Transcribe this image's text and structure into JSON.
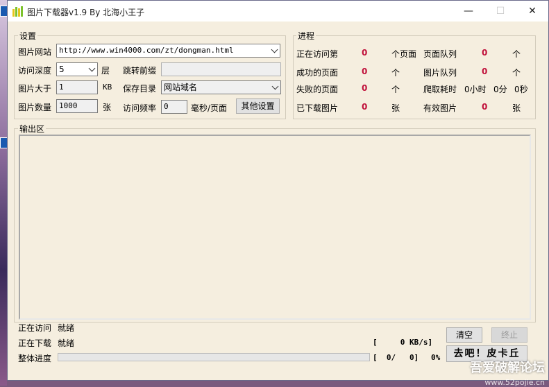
{
  "window": {
    "title": "图片下载器v1.9 By 北海小王子",
    "minimize_glyph": "—",
    "maximize_glyph": "☐",
    "close_glyph": "✕"
  },
  "settings": {
    "group_label": "设置",
    "site_label": "图片网站",
    "site_value": "http://www.win4000.com/zt/dongman.html",
    "depth_label": "访问深度",
    "depth_value": "5",
    "depth_unit": "层",
    "redirect_label": "跳转前缀",
    "redirect_value": "",
    "size_label": "图片大于",
    "size_value": "1",
    "size_unit": "KB",
    "savedir_label": "保存目录",
    "savedir_value": "网站域名",
    "count_label": "图片数量",
    "count_value": "1000",
    "count_unit": "张",
    "freq_label": "访问频率",
    "freq_value": "0",
    "freq_unit": "毫秒/页面",
    "other_settings_button": "其他设置"
  },
  "progress_panel": {
    "group_label": "进程",
    "visiting_label": "正在访问第",
    "visiting_value": "0",
    "visiting_unit": "个页面",
    "page_queue_label": "页面队列",
    "page_queue_value": "0",
    "page_queue_unit": "个",
    "success_label": "成功的页面",
    "success_value": "0",
    "success_unit": "个",
    "image_queue_label": "图片队列",
    "image_queue_value": "0",
    "image_queue_unit": "个",
    "failed_label": "失败的页面",
    "failed_value": "0",
    "failed_unit": "个",
    "elapsed_label": "爬取耗时",
    "elapsed_hours": "0小时",
    "elapsed_minutes": "0分",
    "elapsed_seconds": "0秒",
    "downloaded_label": "已下载图片",
    "downloaded_value": "0",
    "downloaded_unit": "张",
    "valid_label": "有效图片",
    "valid_value": "0",
    "valid_unit": "张"
  },
  "output": {
    "group_label": "输出区"
  },
  "status": {
    "visiting_label": "正在访问",
    "visiting_value": "就绪",
    "downloading_label": "正在下载",
    "downloading_value": "就绪",
    "overall_label": "整体进度",
    "speed_text": "[     0 KB/s]",
    "count_text": "[  0/   0]",
    "percent_text": "0%",
    "overall_progress_percent": 0
  },
  "actions": {
    "clear_button": "清空",
    "stop_button": "终止",
    "go_button": "去吧！皮卡丘"
  },
  "watermark": {
    "text": "吾爱破解论坛",
    "url": "www.52pojie.cn"
  },
  "colors": {
    "window_bg": "#f5eedf",
    "counter_red": "#c0103a",
    "progress_green": "#06b025"
  }
}
